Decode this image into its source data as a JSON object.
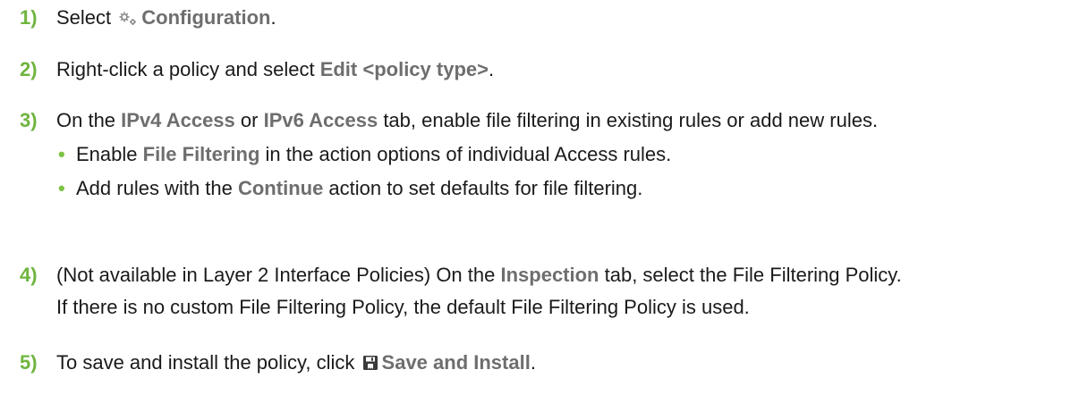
{
  "steps": [
    {
      "number": "1)",
      "pre": "Select ",
      "icon": "gears-icon",
      "ui": "Configuration",
      "post": "."
    },
    {
      "number": "2)",
      "pre": "Right-click a policy and select ",
      "ui": "Edit <policy type>",
      "post": "."
    },
    {
      "number": "3)",
      "pre": "On the ",
      "ui1": "IPv4 Access",
      "mid": " or ",
      "ui2": "IPv6 Access",
      "post": " tab, enable file filtering in existing rules or add new rules.",
      "bullets": [
        {
          "pre": "Enable ",
          "ui": "File Filtering",
          "post": " in the action options of individual Access rules."
        },
        {
          "pre": "Add rules with the ",
          "ui": "Continue",
          "post": " action to set defaults for file filtering."
        }
      ]
    },
    {
      "number": "4)",
      "pre": "(Not available in Layer 2 Interface Policies) On the ",
      "ui": "Inspection",
      "post": " tab, select the File Filtering Policy.",
      "line2": "If there is no custom File Filtering Policy, the default File Filtering Policy is used."
    },
    {
      "number": "5)",
      "pre": "To save and install the policy, click ",
      "icon": "save-and-install-icon",
      "ui": "Save and Install",
      "post": "."
    }
  ],
  "colors": {
    "step_number": "#6fb43f",
    "bullet": "#7cc243",
    "ui_text": "#6e6e6e",
    "body_text": "#1a1a1a"
  }
}
